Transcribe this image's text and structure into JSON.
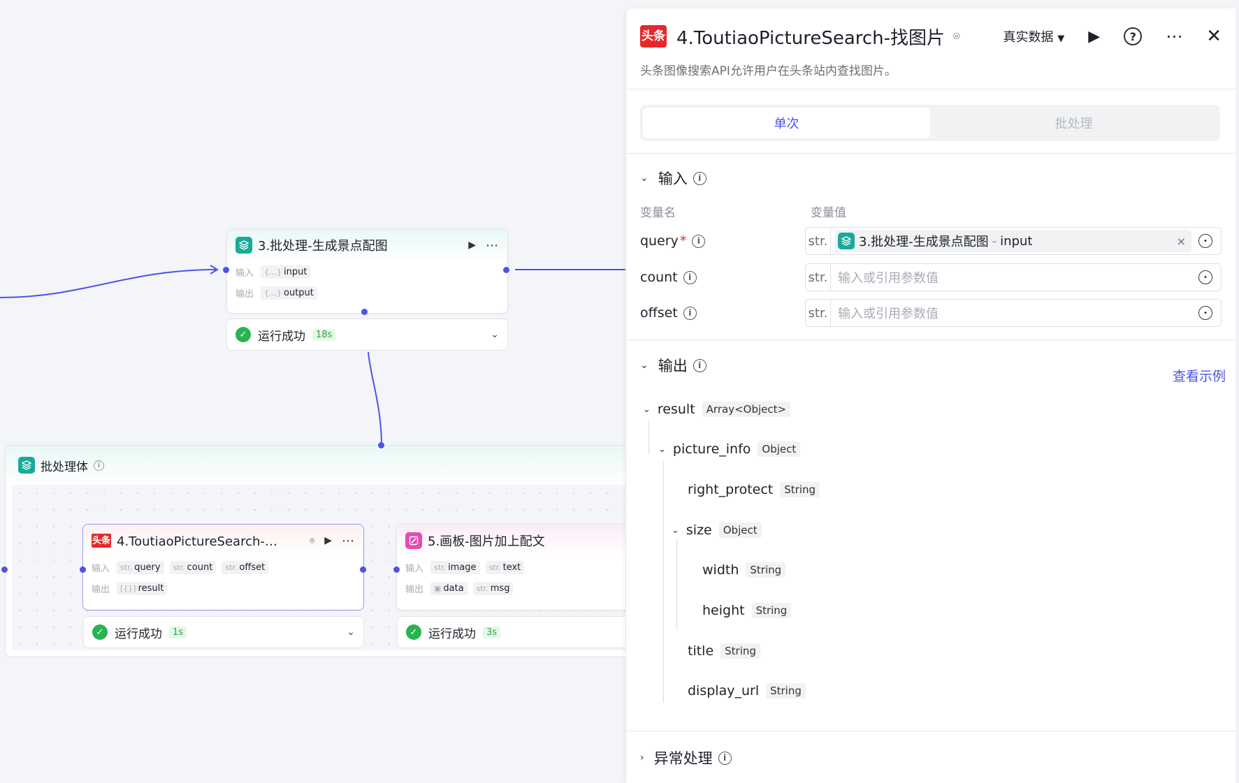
{
  "canvas": {
    "node3": {
      "title": "3.批处理-生成景点配图",
      "input_label": "输入",
      "output_label": "输出",
      "input_var": "input",
      "output_var": "output",
      "status": "运行成功",
      "time": "18s"
    },
    "batch": {
      "title": "批处理体"
    },
    "node4": {
      "title": "4.ToutiaoPictureSearch-找…",
      "icon_text": "头条",
      "input_label": "输入",
      "output_label": "输出",
      "inputs": [
        {
          "type": "str.",
          "name": "query"
        },
        {
          "type": "str.",
          "name": "count"
        },
        {
          "type": "str.",
          "name": "offset"
        }
      ],
      "output": {
        "type": "[{}]",
        "name": "result"
      },
      "status": "运行成功",
      "time": "1s"
    },
    "node5": {
      "title": "5.画板-图片加上配文",
      "input_label": "输入",
      "output_label": "输出",
      "inputs": [
        {
          "type": "str.",
          "name": "image"
        },
        {
          "type": "str.",
          "name": "text"
        }
      ],
      "outputs": [
        {
          "type": "▣",
          "name": "data"
        },
        {
          "type": "str.",
          "name": "msg"
        }
      ],
      "status": "运行成功",
      "time": "3s"
    }
  },
  "panel": {
    "icon_text": "头条",
    "title": "4.ToutiaoPictureSearch-找图片",
    "data_mode": "真实数据",
    "description": "头条图像搜索API允许用户在头条站内查找图片。",
    "tabs": {
      "single": "单次",
      "batch": "批处理"
    },
    "input_section": {
      "title": "输入",
      "col_name": "变量名",
      "col_value": "变量值",
      "rows": [
        {
          "name": "query",
          "required": "*",
          "type": "str.",
          "ref_node": "3.批处理-生成景点配图",
          "ref_sep": "-",
          "ref_var": "input"
        },
        {
          "name": "count",
          "type": "str.",
          "placeholder": "输入或引用参数值"
        },
        {
          "name": "offset",
          "type": "str.",
          "placeholder": "输入或引用参数值"
        }
      ]
    },
    "output_section": {
      "title": "输出",
      "view_example": "查看示例",
      "tree": [
        {
          "name": "result",
          "type": "Array<Object>"
        },
        {
          "name": "picture_info",
          "type": "Object"
        },
        {
          "name": "right_protect",
          "type": "String"
        },
        {
          "name": "size",
          "type": "Object"
        },
        {
          "name": "width",
          "type": "String"
        },
        {
          "name": "height",
          "type": "String"
        },
        {
          "name": "title",
          "type": "String"
        },
        {
          "name": "display_url",
          "type": "String"
        }
      ]
    },
    "error_section": {
      "title": "异常处理"
    }
  },
  "colors": {
    "accent": "#4d53e8",
    "success": "#28b44f",
    "teal": "#1aaa9b",
    "toutiao_red": "#e5292b"
  }
}
